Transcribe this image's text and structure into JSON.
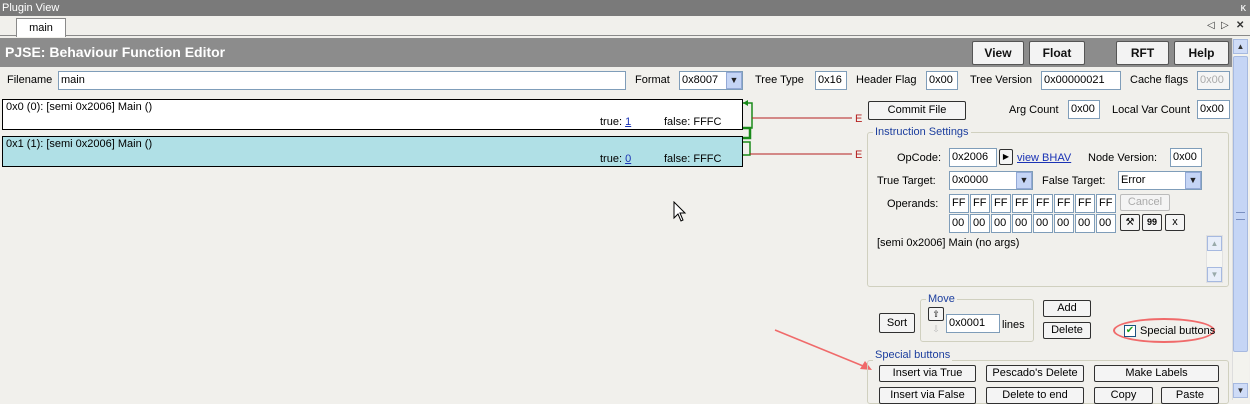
{
  "window": {
    "title": "Plugin View",
    "pin_glyph": "ᵽ",
    "close_glyph": "✕"
  },
  "tabs": [
    {
      "label": "main"
    }
  ],
  "header": {
    "title": "PJSE: Behaviour Function Editor",
    "buttons": {
      "view": "View",
      "float": "Float",
      "rft": "RFT",
      "help": "Help"
    }
  },
  "props": {
    "filename_label": "Filename",
    "filename_value": "main",
    "format_label": "Format",
    "format_value": "0x8007",
    "tree_type_label": "Tree Type",
    "tree_type_value": "0x16",
    "header_flag_label": "Header Flag",
    "header_flag_value": "0x00",
    "tree_version_label": "Tree Version",
    "tree_version_value": "0x00000021",
    "cache_flags_label": "Cache flags",
    "cache_flags_value": "0x00"
  },
  "instructions": [
    {
      "text": "0x0 (0): [semi 0x2006] Main ()",
      "true_label": "true:",
      "true_target": "1",
      "false_label": "false: FFFC",
      "end_marker": "E"
    },
    {
      "text": "0x1 (1): [semi 0x2006] Main ()",
      "true_label": "true:",
      "true_target": "0",
      "false_label": "false: FFFC",
      "end_marker": "E"
    }
  ],
  "right": {
    "commit_file": "Commit File",
    "arg_count_label": "Arg Count",
    "arg_count_value": "0x00",
    "local_var_label": "Local Var Count",
    "local_var_value": "0x00"
  },
  "instruction_settings": {
    "title": "Instruction Settings",
    "opcode_label": "OpCode:",
    "opcode_value": "0x2006",
    "view_bhav": "view BHAV",
    "node_version_label": "Node Version:",
    "node_version_value": "0x00",
    "true_target_label": "True Target:",
    "true_target_value": "0x0000",
    "false_target_label": "False Target:",
    "false_target_value": "Error",
    "operands_label": "Operands:",
    "operands_row1": [
      "FF",
      "FF",
      "FF",
      "FF",
      "FF",
      "FF",
      "FF",
      "FF"
    ],
    "operands_row2": [
      "00",
      "00",
      "00",
      "00",
      "00",
      "00",
      "00",
      "00"
    ],
    "cancel": "Cancel",
    "quote_btn": "99",
    "x_btn": "x",
    "description": "[semi 0x2006] Main (no args)"
  },
  "move": {
    "title": "Move",
    "sort": "Sort",
    "value": "0x0001",
    "lines_label": "lines",
    "add": "Add",
    "delete": "Delete",
    "special_buttons_label": "Special buttons",
    "special_buttons_checked": true
  },
  "special_buttons": {
    "title": "Special buttons",
    "insert_via_true": "Insert via True",
    "pescados_delete": "Pescado's Delete",
    "make_labels": "Make Labels",
    "insert_via_false": "Insert via False",
    "delete_to_end": "Delete to end",
    "copy": "Copy",
    "paste": "Paste"
  },
  "colors": {
    "header_bg": "#8c8c8c",
    "selected_row": "#b0e0e6",
    "link": "#1a33b5",
    "arrow_green": "#1a8a1a",
    "end_red": "#b52020",
    "annotation": "#f06a6a"
  }
}
